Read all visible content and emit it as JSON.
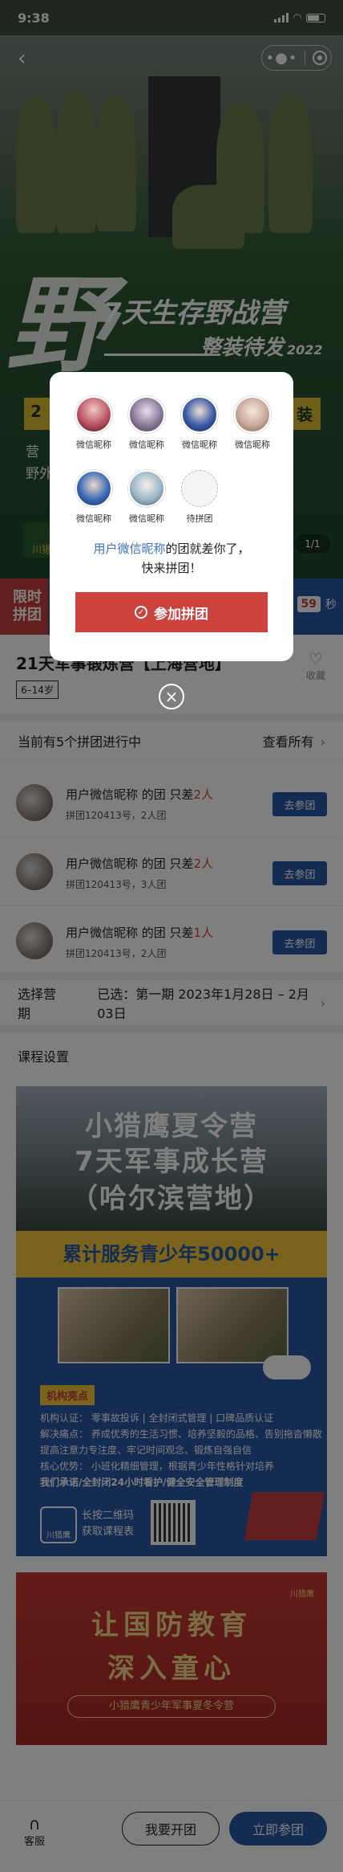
{
  "status_bar": {
    "time": "9:38"
  },
  "hero": {
    "big_char": "野",
    "subtitle1": "7天生存野战营",
    "subtitle2": "整装待发",
    "year": "2022",
    "band_left": "2",
    "band_right": "装",
    "text1": "营",
    "text2": "野外",
    "logo_text": "川猎",
    "page_indicator": "1/1"
  },
  "flash": {
    "label_line1": "限时",
    "label_line2": "拼团",
    "seconds": "59",
    "seconds_unit": "秒"
  },
  "product": {
    "title": "21天军事锻炼营【上海营地】",
    "age_tag": "6–14岁",
    "fav_label": "收藏"
  },
  "groups": {
    "header": "当前有5个拼团进行中",
    "view_all": "查看所有",
    "rows": [
      {
        "user": "用户微信昵称 的团 只差",
        "remain": "2人",
        "detail": "拼团120413号，2人团",
        "button": "去参团"
      },
      {
        "user": "用户微信昵称 的团 只差",
        "remain": "2人",
        "detail": "拼团120413号，3人团",
        "button": "去参团"
      },
      {
        "user": "用户微信昵称 的团 只差",
        "remain": "1人",
        "detail": "拼团120413号，2人团",
        "button": "去参团"
      }
    ]
  },
  "period": {
    "label": "选择营期",
    "selected": "已选：第一期 2023年1月28日 – 2月03日"
  },
  "course": {
    "heading": "课程设置"
  },
  "poster1": {
    "title1": "小猎鹰夏令营",
    "title2": "7天军事成长营",
    "title3": "（哈尔滨营地）",
    "band": "累计服务青少年50000+",
    "tag": "机构亮点",
    "lines": [
      "机构认证：  零事故投诉 | 全封闭式管理 | 口碑品质认证",
      "解决痛点：  养成优秀的生活习惯、培养坚毅的品格、告别拖沓懒散",
      "            提高注意力专注度、牢记时间观念、锻炼自强自信",
      "核心优势：  小班化精细管理，根据青少年性格针对培养",
      "我们承诺/全封闭24小时看护/健全安全管理制度"
    ],
    "logo_text": "川猎鹰",
    "qr_line1": "长按二维码",
    "qr_line2": "获取课程表"
  },
  "poster2": {
    "title1": "让国防教育",
    "title2": "深入童心",
    "pill": "小猎鹰青少年军事夏冬令营",
    "logo_text": "川猎鹰"
  },
  "bottom_bar": {
    "service": "客服",
    "open_group": "我要开团",
    "join_now": "立即参团"
  },
  "modal": {
    "members": [
      {
        "name": "微信昵称"
      },
      {
        "name": "微信昵称"
      },
      {
        "name": "微信昵称"
      },
      {
        "name": "微信昵称"
      },
      {
        "name": "微信昵称"
      },
      {
        "name": "微信昵称"
      },
      {
        "name": "待拼团"
      }
    ],
    "msg_user": "用户微信昵称",
    "msg_rest": "的团就差你了，",
    "msg_line2": "快来拼团！",
    "join_button": "参加拼团"
  },
  "colors": {
    "primary_blue": "#2957a4",
    "accent_red": "#cc433d",
    "highlight_red": "#d8403a"
  }
}
